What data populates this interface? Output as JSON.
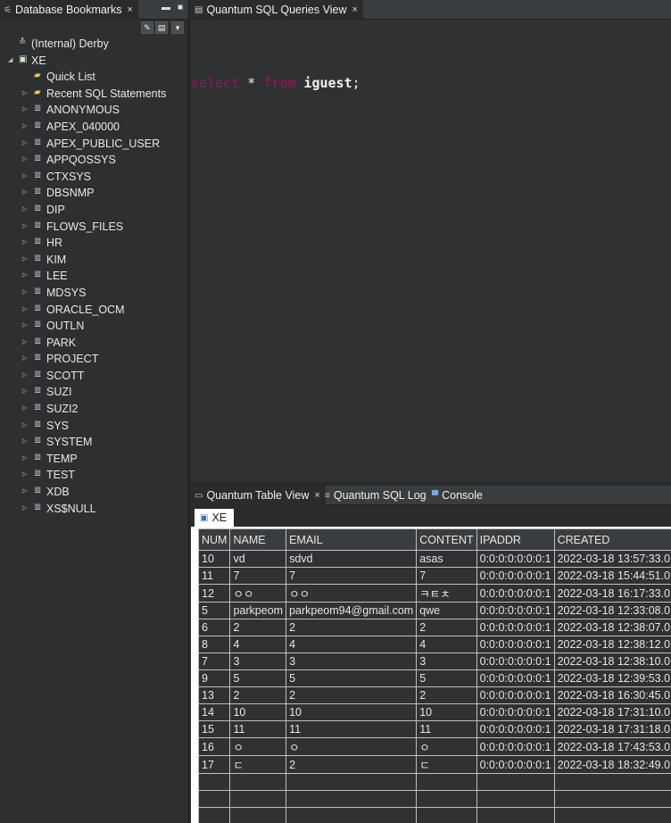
{
  "bookmarks": {
    "tab_label": "Database Bookmarks",
    "tab_close": "×",
    "toolbar": {
      "btn1": "✎",
      "btn2": "▤",
      "btn3": "▾"
    },
    "tree": {
      "derby": "(Internal) Derby",
      "xe": "XE",
      "folders": [
        "Quick List",
        "Recent SQL Statements"
      ],
      "schemas": [
        "ANONYMOUS",
        "APEX_040000",
        "APEX_PUBLIC_USER",
        "APPQOSSYS",
        "CTXSYS",
        "DBSNMP",
        "DIP",
        "FLOWS_FILES",
        "HR",
        "KIM",
        "LEE",
        "MDSYS",
        "ORACLE_OCM",
        "OUTLN",
        "PARK",
        "PROJECT",
        "SCOTT",
        "SUZI",
        "SUZI2",
        "SYS",
        "SYSTEM",
        "TEMP",
        "TEST",
        "XDB",
        "XS$NULL"
      ]
    }
  },
  "editor": {
    "tab_label": "Quantum SQL Queries View",
    "tab_close": "×",
    "code": {
      "kw1": "select",
      "star": " * ",
      "kw2": "from",
      "table": " iguest",
      "semi": ";"
    }
  },
  "bottom": {
    "tabs": [
      {
        "label": "Quantum Table View",
        "close": "×"
      },
      {
        "label": "Quantum SQL Log"
      },
      {
        "label": "Console"
      }
    ],
    "result_tab": "XE",
    "columns": [
      "NUM",
      "NAME",
      "EMAIL",
      "CONTENT",
      "IPADDR",
      "CREATED"
    ],
    "rows": [
      [
        "10",
        "vd",
        "sdvd",
        "asas",
        "0:0:0:0:0:0:0:1",
        "2022-03-18 13:57:33.0"
      ],
      [
        "11",
        "7",
        "7",
        "7",
        "0:0:0:0:0:0:0:1",
        "2022-03-18 15:44:51.0"
      ],
      [
        "12",
        "ㅇㅇ",
        "ㅇㅇ",
        "ㅋㅌㅊ",
        "0:0:0:0:0:0:0:1",
        "2022-03-18 16:17:33.0"
      ],
      [
        "5",
        "parkpeom",
        "parkpeom94@gmail.com",
        "qwe",
        "0:0:0:0:0:0:0:1",
        "2022-03-18 12:33:08.0"
      ],
      [
        "6",
        "2",
        "2",
        "2",
        "0:0:0:0:0:0:0:1",
        "2022-03-18 12:38:07.0"
      ],
      [
        "8",
        "4",
        "4",
        "4",
        "0:0:0:0:0:0:0:1",
        "2022-03-18 12:38:12.0"
      ],
      [
        "7",
        "3",
        "3",
        "3",
        "0:0:0:0:0:0:0:1",
        "2022-03-18 12:38:10.0"
      ],
      [
        "9",
        "5",
        "5",
        "5",
        "0:0:0:0:0:0:0:1",
        "2022-03-18 12:39:53.0"
      ],
      [
        "13",
        "2",
        "2",
        "2",
        "0:0:0:0:0:0:0:1",
        "2022-03-18 16:30:45.0"
      ],
      [
        "14",
        "10",
        "10",
        "10",
        "0:0:0:0:0:0:0:1",
        "2022-03-18 17:31:10.0"
      ],
      [
        "15",
        "11",
        "11",
        "11",
        "0:0:0:0:0:0:0:1",
        "2022-03-18 17:31:18.0"
      ],
      [
        "16",
        "ㅇ",
        "ㅇ",
        "ㅇ",
        "0:0:0:0:0:0:0:1",
        "2022-03-18 17:43:53.0"
      ],
      [
        "17",
        "ㄷ",
        "2",
        "ㄷ",
        "0:0:0:0:0:0:0:1",
        "2022-03-18 18:32:49.0"
      ]
    ]
  }
}
